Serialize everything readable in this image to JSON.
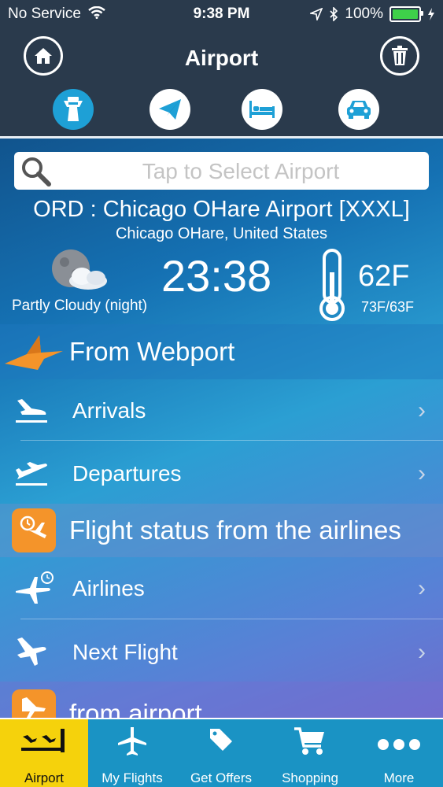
{
  "status_bar": {
    "carrier": "No Service",
    "time": "9:38 PM",
    "battery": "100%"
  },
  "nav": {
    "title": "Airport"
  },
  "search": {
    "placeholder": "Tap to Select Airport"
  },
  "airport": {
    "title": "ORD : Chicago OHare Airport [XXXL]",
    "subtitle": "Chicago OHare, United States",
    "local_time": "23:38",
    "condition": "Partly Cloudy (night)",
    "temperature": "62F",
    "hi_lo": "73F/63F"
  },
  "sections": {
    "webport": "From Webport",
    "flight_status": "Flight status from the airlines",
    "from_airport": "from airport"
  },
  "rows": {
    "arrivals": "Arrivals",
    "departures": "Departures",
    "airlines": "Airlines",
    "next_flight": "Next Flight"
  },
  "tabs": [
    {
      "label": "Airport"
    },
    {
      "label": "My Flights"
    },
    {
      "label": "Get Offers"
    },
    {
      "label": "Shopping"
    },
    {
      "label": "More"
    }
  ],
  "colors": {
    "active_tab": "#f5d20c",
    "tab_bar": "#1a93c4",
    "nav_bg": "#2a3a4c",
    "accent_orange": "#f4942a"
  }
}
